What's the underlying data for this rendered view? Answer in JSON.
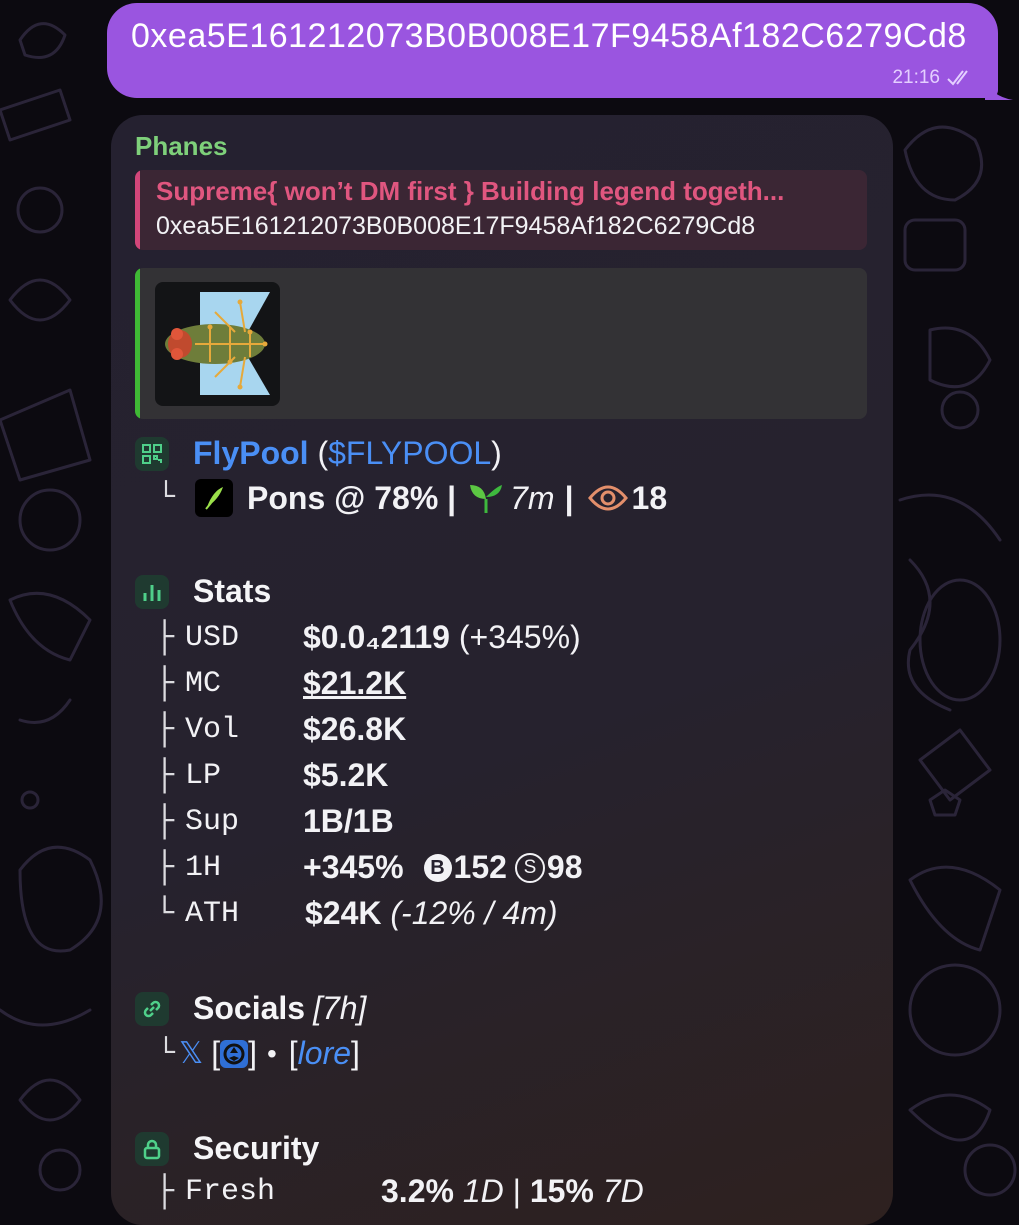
{
  "outgoing": {
    "text": "0xea5E161212073B0B008E17F9458Af182C6279Cd8",
    "time": "21:16"
  },
  "incoming": {
    "sender": "Phanes",
    "reply": {
      "name": "Supreme{ won’t DM first } Building legend togeth...",
      "text": "0xea5E161212073B0B008E17F9458Af182C6279Cd8"
    },
    "token": {
      "name": "FlyPool",
      "open_paren": "(",
      "ticker": "$FLYPOOL",
      "close_paren": ")",
      "branch": "└",
      "line_main": "Pons @ 78% |",
      "age": "7m",
      "sep": "|",
      "views": "18"
    },
    "stats": {
      "title": "Stats",
      "rows": [
        {
          "branch": "├",
          "key": "USD",
          "value": "$0.0₄2119",
          "extra": "(+345%)"
        },
        {
          "branch": "├",
          "key": "MC",
          "value": "$21.2K"
        },
        {
          "branch": "├",
          "key": "Vol",
          "value": "$26.8K"
        },
        {
          "branch": "├",
          "key": "LP",
          "value": "$5.2K"
        },
        {
          "branch": "├",
          "key": "Sup",
          "value": "1B/1B"
        },
        {
          "branch": "├",
          "key": "1H",
          "value": "+345%",
          "buys": "152",
          "sells": "98"
        },
        {
          "branch": "└",
          "key": "ATH",
          "value": "$24K",
          "extra": "(-12% / 4m)"
        }
      ]
    },
    "socials": {
      "title": "Socials",
      "age": "[7h]",
      "branch": "└",
      "x_icon": "𝕏",
      "bracket_open": "[",
      "bracket_close": "]",
      "dot": "•",
      "lore_open": "[",
      "lore": "lore",
      "lore_close": "]"
    },
    "security": {
      "title": "Security",
      "partial_branch": "├",
      "partial_key": "Fresh",
      "partial_value": "3.2%",
      "partial_v1": "1D",
      "partial_sep": "|",
      "partial_value2": "15%",
      "partial_v2": "7D"
    }
  },
  "colors": {
    "outgoing_bubble": "#9a55e0",
    "sender": "#7ed07a",
    "reply_accent": "#d2467a",
    "preview_accent": "#3fb935",
    "link": "#4a8ff5"
  }
}
